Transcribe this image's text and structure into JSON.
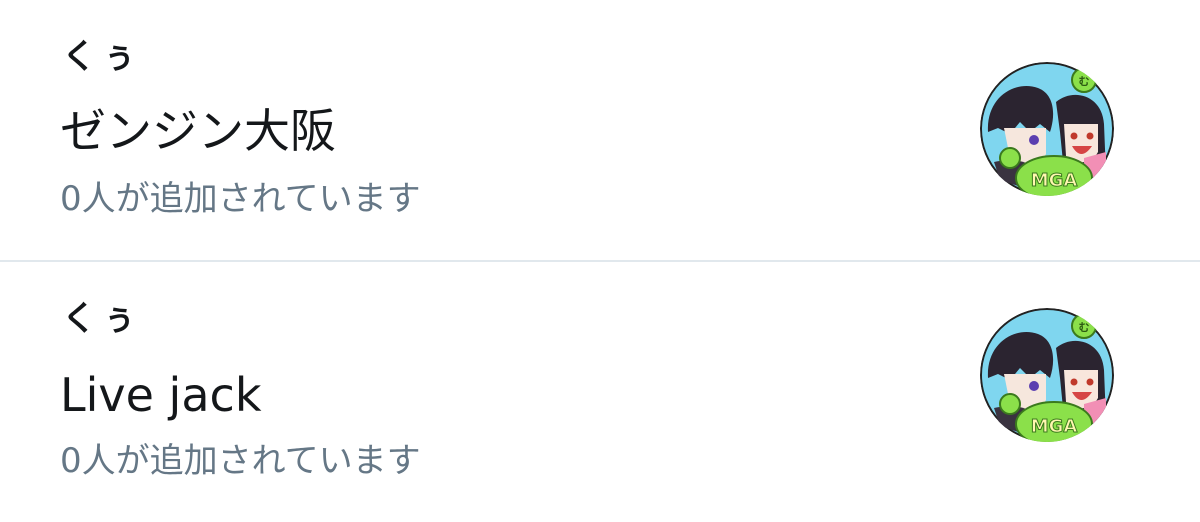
{
  "lists": [
    {
      "owner": "くぅ",
      "name": "ゼンジン大阪",
      "members": "0人が追加されています",
      "avatar": {
        "badge_text": "MGA",
        "leaf_text": "む"
      }
    },
    {
      "owner": "くぅ",
      "name": "Live jack",
      "members": "0人が追加されています",
      "avatar": {
        "badge_text": "MGA",
        "leaf_text": "む"
      }
    }
  ],
  "colors": {
    "text_primary": "#14171a",
    "text_secondary": "#657786",
    "divider": "#e1e8ed",
    "avatar_bg": "#7fd6ef",
    "apple_green": "#8be04a"
  }
}
